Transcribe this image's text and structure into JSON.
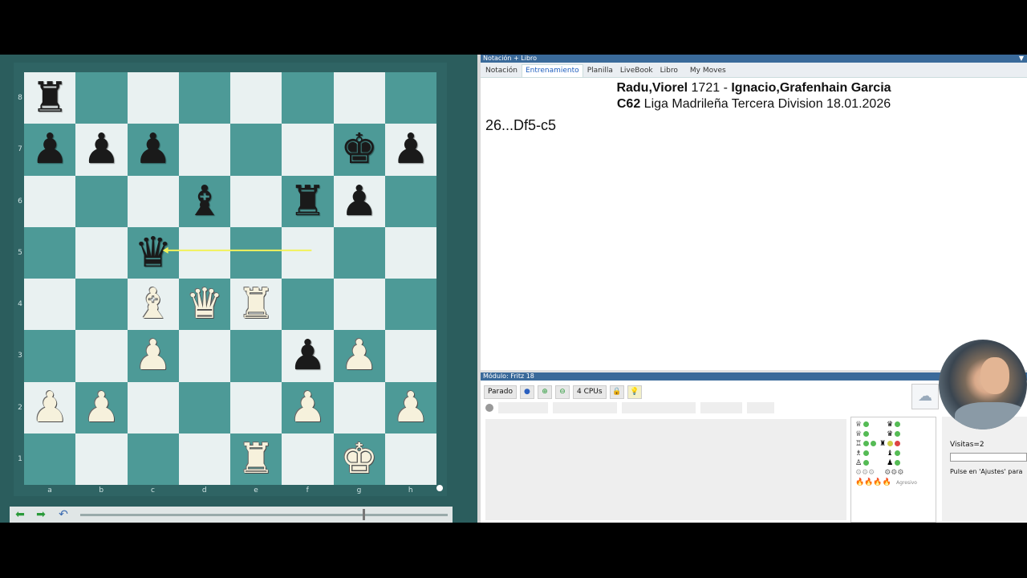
{
  "notation": {
    "title": "Notación + Libro",
    "tabs": [
      "Notación",
      "Entrenamiento",
      "Planilla",
      "LiveBook",
      "Libro",
      "My Moves"
    ],
    "active_tab": "Entrenamiento",
    "white_player": "Radu,Viorel",
    "white_elo": "1721",
    "separator": "-",
    "black_player": "Ignacio,Grafenhain Garcia",
    "eco": "C62",
    "event_line": "Liga Madrileña Tercera Division 18.01.2026",
    "move": "26...Df5-c5"
  },
  "engine": {
    "title": "Módulo: Fritz 18",
    "status_button": "Parado",
    "cpus_button": "4 CPUs",
    "visits": "Visitas=2",
    "ajustes_hint": "Pulse en 'Ajustes' para",
    "personality_label": "Agresivo"
  },
  "board": {
    "ranks": [
      "8",
      "7",
      "6",
      "5",
      "4",
      "3",
      "2",
      "1"
    ],
    "files": [
      "a",
      "b",
      "c",
      "d",
      "e",
      "f",
      "g",
      "h"
    ],
    "position": [
      [
        "br",
        "",
        "",
        "",
        "",
        "",
        "",
        ""
      ],
      [
        "bp",
        "bp",
        "bp",
        "",
        "",
        "",
        "bk",
        "bp"
      ],
      [
        "",
        "",
        "",
        "bb",
        "",
        "br",
        "bp",
        ""
      ],
      [
        "",
        "",
        "bq",
        "",
        "",
        "",
        "",
        ""
      ],
      [
        "",
        "",
        "wb",
        "wq",
        "wr",
        "",
        "",
        ""
      ],
      [
        "",
        "",
        "wp",
        "",
        "",
        "bp",
        "wp",
        ""
      ],
      [
        "wp",
        "wp",
        "",
        "",
        "",
        "wp",
        "",
        "wp"
      ],
      [
        "",
        "",
        "",
        "",
        "wr",
        "",
        "wk",
        ""
      ]
    ],
    "last_move_arrow": {
      "from": "f5",
      "to": "c5",
      "color": "#f2f25a"
    },
    "light_color": "#e9f1f1",
    "dark_color": "#4d9a97"
  },
  "nav": {
    "back_icon": "arrow-left-icon",
    "forward_icon": "arrow-right-icon",
    "undo_icon": "undo-icon"
  }
}
